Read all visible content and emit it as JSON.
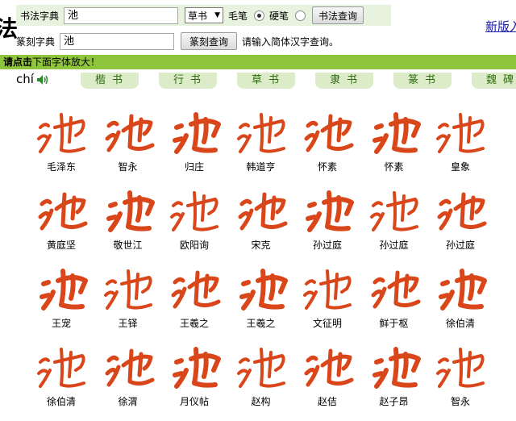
{
  "top": {
    "logo_fragment": "法",
    "row1_label": "书法字典",
    "row1_value": "池",
    "style_select": "草书",
    "brush_label": "毛笔",
    "pen_label": "硬笔",
    "row1_button": "书法查询",
    "row2_label": "篆刻字典",
    "row2_value": "池",
    "row2_button": "篆刻查询",
    "row2_hint": "请输入简体汉字查询。",
    "new_link": "新版入"
  },
  "greenbar": {
    "click": "请点击",
    "rest": "下面字体放大！"
  },
  "tabs": {
    "pinyin": "chí",
    "items": [
      "楷书",
      "行书",
      "草书",
      "隶书",
      "篆书",
      "魏碑"
    ]
  },
  "grid": {
    "captions": [
      [
        "毛泽东",
        "智永",
        "归庄",
        "韩道亨",
        "怀素",
        "怀素",
        "皇象"
      ],
      [
        "黄庭坚",
        "敬世江",
        "欧阳询",
        "宋克",
        "孙过庭",
        "孙过庭",
        "孙过庭"
      ],
      [
        "王宠",
        "王铎",
        "王羲之",
        "王羲之",
        "文征明",
        "鲜于枢",
        "徐伯清"
      ],
      [
        "徐伯清",
        "徐渭",
        "月仪帖",
        "赵构",
        "赵佶",
        "赵子昂",
        "智永"
      ]
    ]
  },
  "colors": {
    "green_bar": "#8fc43d",
    "tab_bg": "#dcecc8",
    "calligraphy_red": "#d9461a",
    "link_blue": "#1a1aa6"
  }
}
